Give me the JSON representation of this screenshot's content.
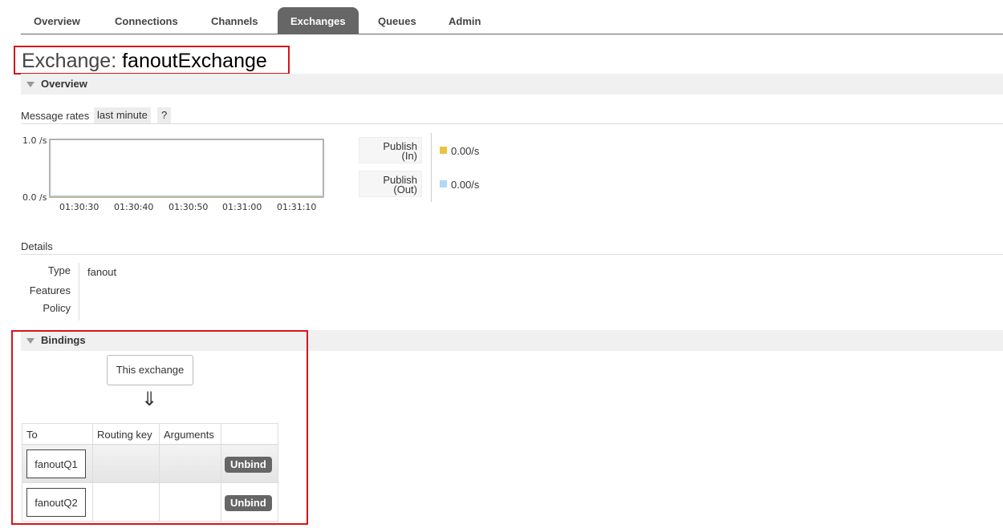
{
  "nav": {
    "tabs": [
      "Overview",
      "Connections",
      "Channels",
      "Exchanges",
      "Queues",
      "Admin"
    ],
    "active": "Exchanges"
  },
  "page": {
    "title_prefix": "Exchange:",
    "exchange_name": "fanoutExchange"
  },
  "overview": {
    "header": "Overview",
    "message_rates_label": "Message rates",
    "rate_period": "last minute",
    "help_label": "?",
    "chart": {
      "y_ticks": [
        "1.0 /s",
        "0.0 /s"
      ],
      "x_ticks": [
        "01:30:30",
        "01:30:40",
        "01:30:50",
        "01:31:00",
        "01:31:10"
      ]
    },
    "legend": [
      {
        "label_line1": "Publish",
        "label_line2": "(In)",
        "value": "0.00/s",
        "color": "#edc240"
      },
      {
        "label_line1": "Publish",
        "label_line2": "(Out)",
        "value": "0.00/s",
        "color": "#afd8f8"
      }
    ],
    "details_label": "Details",
    "details": [
      {
        "key": "Type",
        "value": "fanout"
      },
      {
        "key": "Features",
        "value": ""
      },
      {
        "key": "Policy",
        "value": ""
      }
    ]
  },
  "chart_data": {
    "type": "line",
    "x": [
      "01:30:30",
      "01:30:40",
      "01:30:50",
      "01:31:00",
      "01:31:10"
    ],
    "ylim": [
      0,
      1
    ],
    "series": [
      {
        "name": "Publish (In)",
        "values": [
          0,
          0,
          0,
          0,
          0
        ],
        "color": "#edc240"
      },
      {
        "name": "Publish (Out)",
        "values": [
          0,
          0,
          0,
          0,
          0
        ],
        "color": "#afd8f8"
      }
    ]
  },
  "bindings": {
    "header": "Bindings",
    "source_label": "This exchange",
    "arrow": "⇓",
    "columns": [
      "To",
      "Routing key",
      "Arguments",
      ""
    ],
    "rows": [
      {
        "to": "fanoutQ1",
        "routing_key": "",
        "arguments": "",
        "action": "Unbind"
      },
      {
        "to": "fanoutQ2",
        "routing_key": "",
        "arguments": "",
        "action": "Unbind"
      }
    ]
  }
}
